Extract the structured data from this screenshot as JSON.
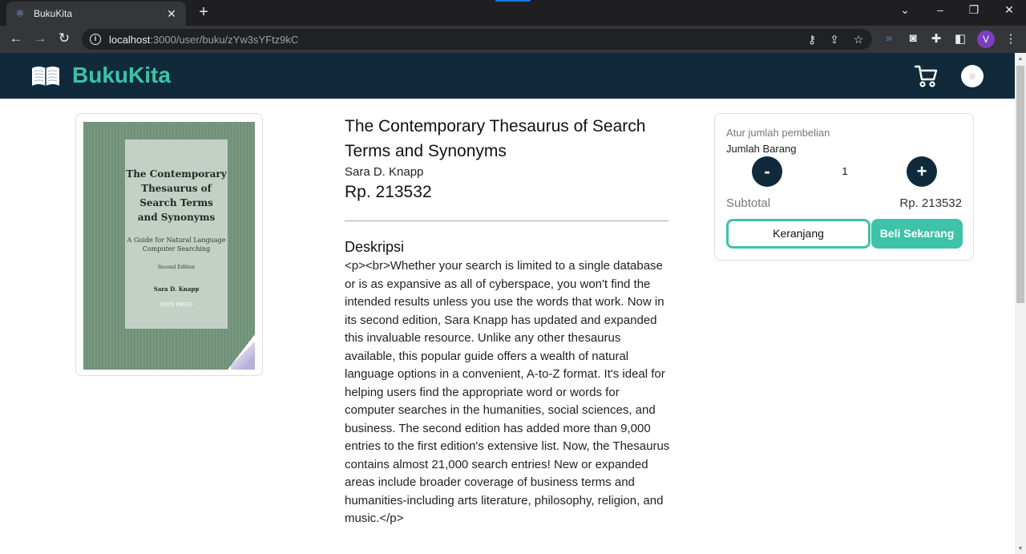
{
  "browser": {
    "tab_title": "BukuKita",
    "tab_close": "✕",
    "new_tab": "+",
    "url_host": "localhost",
    "url_path": ":3000/user/buku/zYw3sYFtz9kC",
    "profile_initial": "V",
    "icons": [
      "react-favicon-icon",
      "back-icon",
      "forward-icon",
      "reload-icon",
      "info-icon",
      "key-icon",
      "share-icon",
      "star-icon",
      "extension-arrows-icon",
      "camera-icon",
      "puzzle-icon",
      "sidepanel-icon",
      "menu-dots-icon",
      "minimize-icon",
      "restore-icon",
      "close-icon",
      "chevron-down-icon"
    ]
  },
  "app": {
    "brand": "BukuKita",
    "accent_color": "#3ec2a8",
    "nav_color": "#102a3c"
  },
  "book": {
    "cover": {
      "title_lines": [
        "The Contemporary",
        "Thesaurus of",
        "Search Terms",
        "and Synonyms"
      ],
      "subtitle_lines": [
        "A Guide for Natural Language",
        "Computer Searching"
      ],
      "edition": "Second Edition",
      "author": "Sara D. Knapp",
      "publisher": "ORYX PRESS"
    },
    "title": "The Contemporary Thesaurus of Search Terms and Synonyms",
    "author": "Sara D. Knapp",
    "price": "Rp. 213532",
    "description_heading": "Deskripsi",
    "description": "<p><br>Whether your search is limited to a single database or is as expansive as all of cyberspace, you won't find the intended results unless you use the words that work. Now in its second edition, Sara Knapp has updated and expanded this invaluable resource. Unlike any other thesaurus available, this popular guide offers a wealth of natural language options in a convenient, A-to-Z format. It's ideal for helping users find the appropriate word or words for computer searches in the humanities, social sciences, and business. The second edition has added more than 9,000 entries to the first edition's extensive list. Now, the Thesaurus contains almost 21,000 search entries! New or expanded areas include broader coverage of business terms and humanities-including arts literature, philosophy, religion, and music.</p>"
  },
  "purchase": {
    "heading": "Atur jumlah pembelian",
    "quantity_label": "Jumlah Barang",
    "minus": "-",
    "plus": "+",
    "quantity": "1",
    "subtotal_label": "Subtotal",
    "subtotal_value": "Rp. 213532",
    "cart_button": "Keranjang",
    "buy_button": "Beli Sekarang"
  }
}
